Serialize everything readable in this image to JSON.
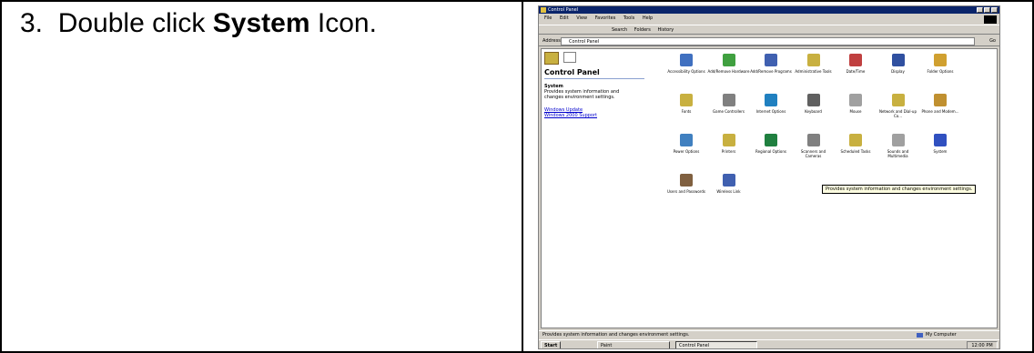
{
  "instruction": {
    "step_number": "3.",
    "prefix": "Double click",
    "emphasis": "System",
    "suffix": "Icon."
  },
  "window": {
    "title": "Control Panel",
    "menu": [
      "File",
      "Edit",
      "View",
      "Favorites",
      "Tools",
      "Help"
    ],
    "toolbar": [
      "Search",
      "Folders",
      "History"
    ],
    "address_label": "Address",
    "address_value": "Control Panel",
    "go_label": "Go",
    "left_pane": {
      "title": "Control Panel",
      "selected_title": "System",
      "selected_desc": "Provides system information and changes environment settings.",
      "links": [
        "Windows Update",
        "Windows 2000 Support"
      ]
    },
    "icons": [
      {
        "label": "Accessibility Options",
        "color": "#4070c0"
      },
      {
        "label": "Add/Remove Hardware",
        "color": "#40a040"
      },
      {
        "label": "Add/Remove Programs",
        "color": "#4060b0"
      },
      {
        "label": "Administrative Tools",
        "color": "#c8b040"
      },
      {
        "label": "Date/Time",
        "color": "#c04040"
      },
      {
        "label": "Display",
        "color": "#3050a0"
      },
      {
        "label": "Folder Options",
        "color": "#d0a030"
      },
      {
        "label": "Fonts",
        "color": "#c8b040"
      },
      {
        "label": "Game Controllers",
        "color": "#808080"
      },
      {
        "label": "Internet Options",
        "color": "#2080c0"
      },
      {
        "label": "Keyboard",
        "color": "#606060"
      },
      {
        "label": "Mouse",
        "color": "#a0a0a0"
      },
      {
        "label": "Network and Dial-up Co...",
        "color": "#c8b040"
      },
      {
        "label": "Phone and Modem...",
        "color": "#c09030"
      },
      {
        "label": "Power Options",
        "color": "#4080c0"
      },
      {
        "label": "Printers",
        "color": "#c8b040"
      },
      {
        "label": "Regional Options",
        "color": "#208040"
      },
      {
        "label": "Scanners and Cameras",
        "color": "#808080"
      },
      {
        "label": "Scheduled Tasks",
        "color": "#c8b040"
      },
      {
        "label": "Sounds and Multimedia",
        "color": "#a0a0a0"
      },
      {
        "label": "System",
        "color": "#3050c0"
      },
      {
        "label": "Users and Passwords",
        "color": "#806040"
      },
      {
        "label": "Wireless Link",
        "color": "#4060b0"
      }
    ],
    "tooltip": "Provides system information and changes environment settings.",
    "status_left": "Provides system information and changes environment settings.",
    "status_right": "My Computer",
    "taskbar": {
      "start": "Start",
      "task1": "Paint",
      "task2": "Control Panel",
      "clock": "12:00 PM"
    }
  }
}
